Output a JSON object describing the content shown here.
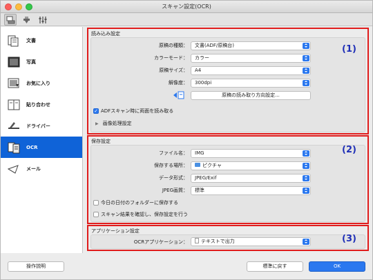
{
  "window": {
    "title": "スキャン設定(OCR)"
  },
  "toolbar": {
    "icons": [
      "scan-from-computer-icon",
      "scan-from-panel-icon",
      "general-settings-icon"
    ]
  },
  "sidebar": {
    "items": [
      {
        "label": "文書",
        "icon": "document-icon"
      },
      {
        "label": "写真",
        "icon": "photo-icon"
      },
      {
        "label": "お気に入り",
        "icon": "favorite-icon"
      },
      {
        "label": "貼り合わせ",
        "icon": "stitch-icon"
      },
      {
        "label": "ドライバー",
        "icon": "driver-icon"
      },
      {
        "label": "OCR",
        "icon": "ocr-icon",
        "selected": true
      },
      {
        "label": "メール",
        "icon": "mail-icon"
      }
    ]
  },
  "scan_options": {
    "title": "読み込み設定",
    "number": "(1)",
    "source_label": "原稿の種類：",
    "source_value": "文書(ADF/原稿台)",
    "color_label": "カラーモード：",
    "color_value": "カラー",
    "size_label": "原稿サイズ：",
    "size_value": "A4",
    "resolution_label": "解像度：",
    "resolution_value": "300dpi",
    "orientation_button": "原稿の読み取り方向設定...",
    "adf_duplex_label": "ADFスキャン時に両面を読み取る",
    "adf_duplex_checked": true,
    "image_processing_label": "画像処理設定"
  },
  "save_settings": {
    "title": "保存設定",
    "number": "(2)",
    "filename_label": "ファイル名：",
    "filename_value": "IMG",
    "save_in_label": "保存する場所：",
    "save_in_value": "ピクチャ",
    "format_label": "データ形式：",
    "format_value": "JPEG/Exif",
    "jpeg_quality_label": "JPEG画質：",
    "jpeg_quality_value": "標準",
    "date_folder_label": "今日の日付のフォルダーに保存する",
    "date_folder_checked": false,
    "check_results_label": "スキャン結果を確認し、保存設定を行う",
    "check_results_checked": false
  },
  "app_settings": {
    "title": "アプリケーション設定",
    "number": "(3)",
    "ocr_app_label": "OCRアプリケーション：",
    "ocr_app_value": "テキストで出力"
  },
  "footer": {
    "instructions_button": "操作説明",
    "defaults_button": "標準に戻す",
    "ok_button": "OK"
  },
  "colors": {
    "accent": "#2b78ef",
    "highlight": "#e01b1b",
    "selection": "#0f63d8",
    "number": "#1f2fb7"
  }
}
